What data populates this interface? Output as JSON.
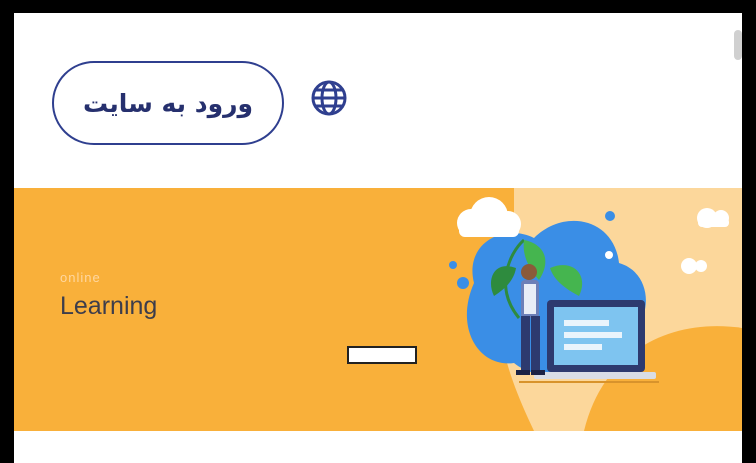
{
  "header": {
    "login_label": "ورود به سایت",
    "language_icon": "globe-icon"
  },
  "banner": {
    "small_text": "online",
    "title": "Learning",
    "button_label": "",
    "illustration": "online-learning-illustration"
  },
  "colors": {
    "accent": "#2f3f8f",
    "banner_bg": "#f9b03a",
    "banner_light": "#fcd79b",
    "blob": "#3a8ee6"
  }
}
